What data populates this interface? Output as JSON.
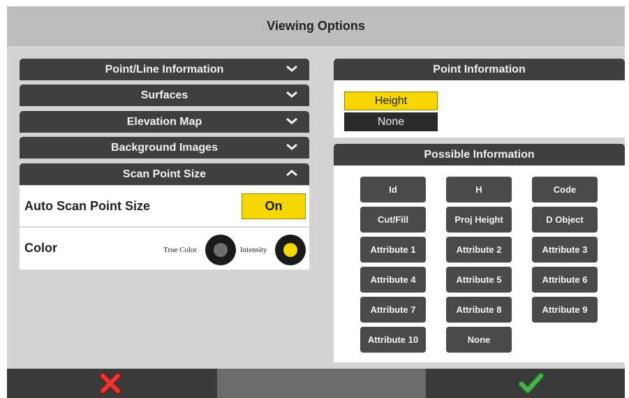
{
  "window": {
    "title": "Viewing Options"
  },
  "left_sections": [
    {
      "label": "Point/Line Information",
      "expanded": false
    },
    {
      "label": "Surfaces",
      "expanded": false
    },
    {
      "label": "Elevation Map",
      "expanded": false
    },
    {
      "label": "Background Images",
      "expanded": false
    },
    {
      "label": "Scan Point Size",
      "expanded": true
    }
  ],
  "scan_point_size": {
    "auto_label": "Auto Scan Point Size",
    "auto_value": "On",
    "color_label": "Color",
    "color_options": [
      {
        "label": "True Color",
        "selected": false
      },
      {
        "label": "Intensity",
        "selected": true
      }
    ]
  },
  "point_information": {
    "title": "Point Information",
    "items": [
      "Height",
      "None"
    ],
    "selected": "Height"
  },
  "possible_information": {
    "title": "Possible Information",
    "items": [
      "Id",
      "H",
      "Code",
      "Cut/Fill",
      "Proj Height",
      "D Object",
      "Attribute 1",
      "Attribute 2",
      "Attribute 3",
      "Attribute 4",
      "Attribute 5",
      "Attribute 6",
      "Attribute 7",
      "Attribute 8",
      "Attribute 9",
      "Attribute 10",
      "None"
    ]
  },
  "colors": {
    "accent": "#f4d600",
    "header_dark": "#3f3f3f",
    "cancel": "#e53935",
    "confirm": "#4caf50"
  },
  "icons": {
    "cancel": "x-icon",
    "confirm": "checkmark-icon"
  }
}
